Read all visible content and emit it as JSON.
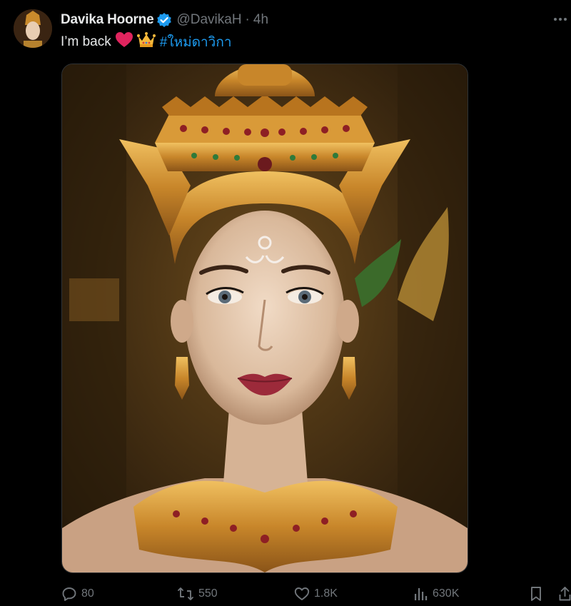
{
  "author": {
    "display_name": "Davika Hoorne",
    "handle": "@DavikaH",
    "separator": "·",
    "time": "4h",
    "verified": true
  },
  "tweet": {
    "text": "I’m back",
    "emojis": [
      "red-heart",
      "crown"
    ],
    "hashtag": "#ใหม่ดาวิกา",
    "image_description_icon": "portrait-photo"
  },
  "actions": {
    "replies": "80",
    "retweets": "550",
    "likes": "1.8K",
    "views": "630K"
  },
  "colors": {
    "background": "#000000",
    "text": "#e7e9ea",
    "muted": "#71767b",
    "link": "#1d9bf0",
    "verified": "#1d9bf0",
    "heart": "#e0245e"
  }
}
